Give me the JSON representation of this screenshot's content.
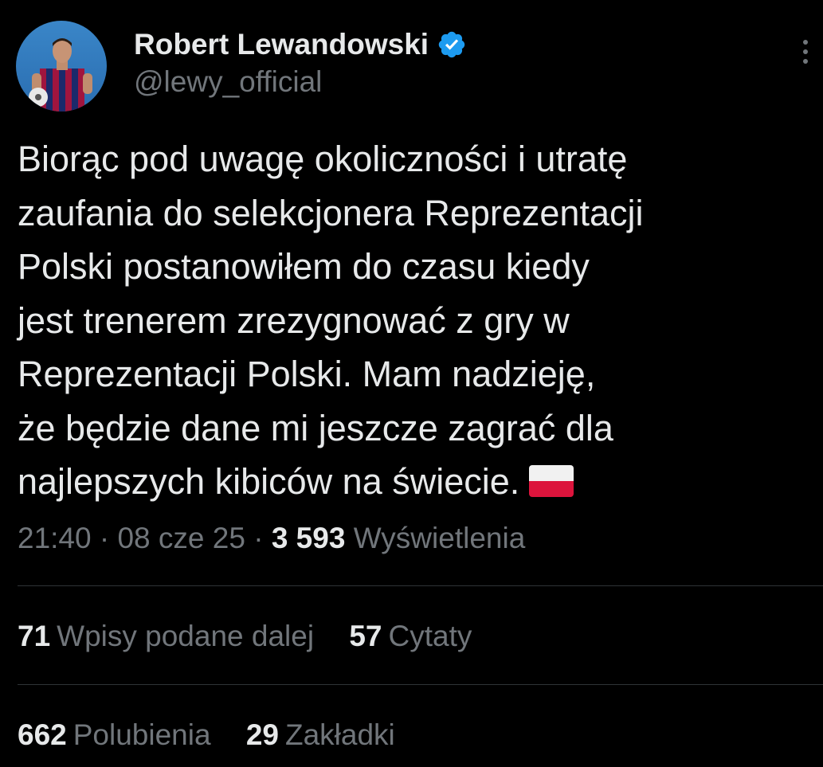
{
  "author": {
    "display_name": "Robert Lewandowski",
    "handle": "@lewy_official",
    "verified": true,
    "verified_color": "#1d9bf0"
  },
  "tweet": {
    "lines": [
      "Biorąc pod uwagę okoliczności i utratę",
      "zaufania do selekcjonera Reprezentacji",
      "Polski postanowiłem do czasu kiedy",
      "jest trenerem zrezygnować z gry w",
      "Reprezentacji Polski. Mam nadzieję,",
      "że będzie dane mi jeszcze zagrać dla",
      "najlepszych kibiców na świecie."
    ],
    "emoji": "poland-flag"
  },
  "meta": {
    "time": "21:40",
    "separator": "·",
    "date": "08 cze 25",
    "views_count": "3 593",
    "views_label": "Wyświetlenia"
  },
  "stats_row1": [
    {
      "count": "71",
      "label": "Wpisy podane dalej"
    },
    {
      "count": "57",
      "label": "Cytaty"
    }
  ],
  "stats_row2": [
    {
      "count": "662",
      "label": "Polubienia"
    },
    {
      "count": "29",
      "label": "Zakładki"
    }
  ],
  "icons": {
    "more": "more-vertical-icon",
    "verified": "verified-badge-icon"
  }
}
